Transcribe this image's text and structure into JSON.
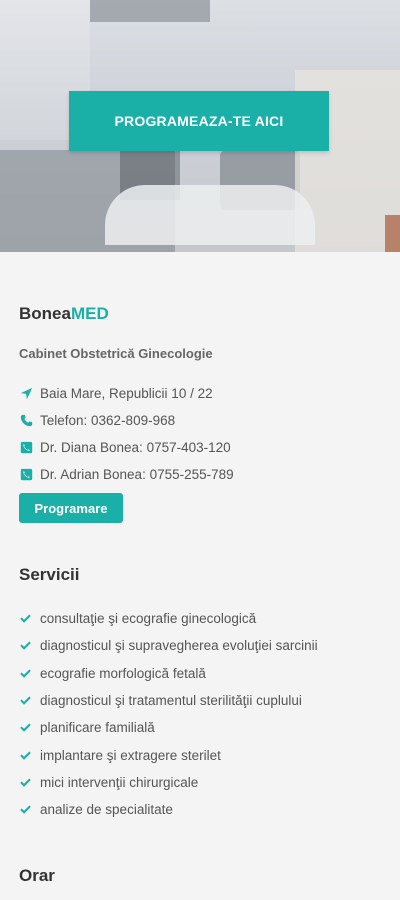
{
  "hero": {
    "cta_label": "PROGRAMEAZA-TE AICI"
  },
  "brand": {
    "name_part1": "Bonea",
    "name_part2": "MED",
    "accent_color": "#1ab0a8"
  },
  "subtitle": "Cabinet Obstetrică Ginecologie",
  "contacts": [
    {
      "icon": "location-arrow-icon",
      "text": "Baia Mare, Republicii 10 / 22"
    },
    {
      "icon": "phone-icon",
      "text": "Telefon: 0362-809-968"
    },
    {
      "icon": "phone-square-icon",
      "text": "Dr. Diana Bonea: 0757-403-120"
    },
    {
      "icon": "phone-square-icon",
      "text": "Dr. Adrian Bonea: 0755-255-789"
    }
  ],
  "programare_label": "Programare",
  "servicii": {
    "title": "Servicii",
    "items": [
      "consultaţie şi ecografie ginecologică",
      "diagnosticul şi supravegherea evoluţiei sarcinii",
      "ecografie morfologică fetală",
      "diagnosticul şi tratamentul sterilităţii cuplului",
      "planificare familială",
      "implantare şi extragere sterilet",
      "mici intervenţii chirurgicale",
      "analize de specialitate"
    ]
  },
  "orar": {
    "title": "Orar"
  }
}
